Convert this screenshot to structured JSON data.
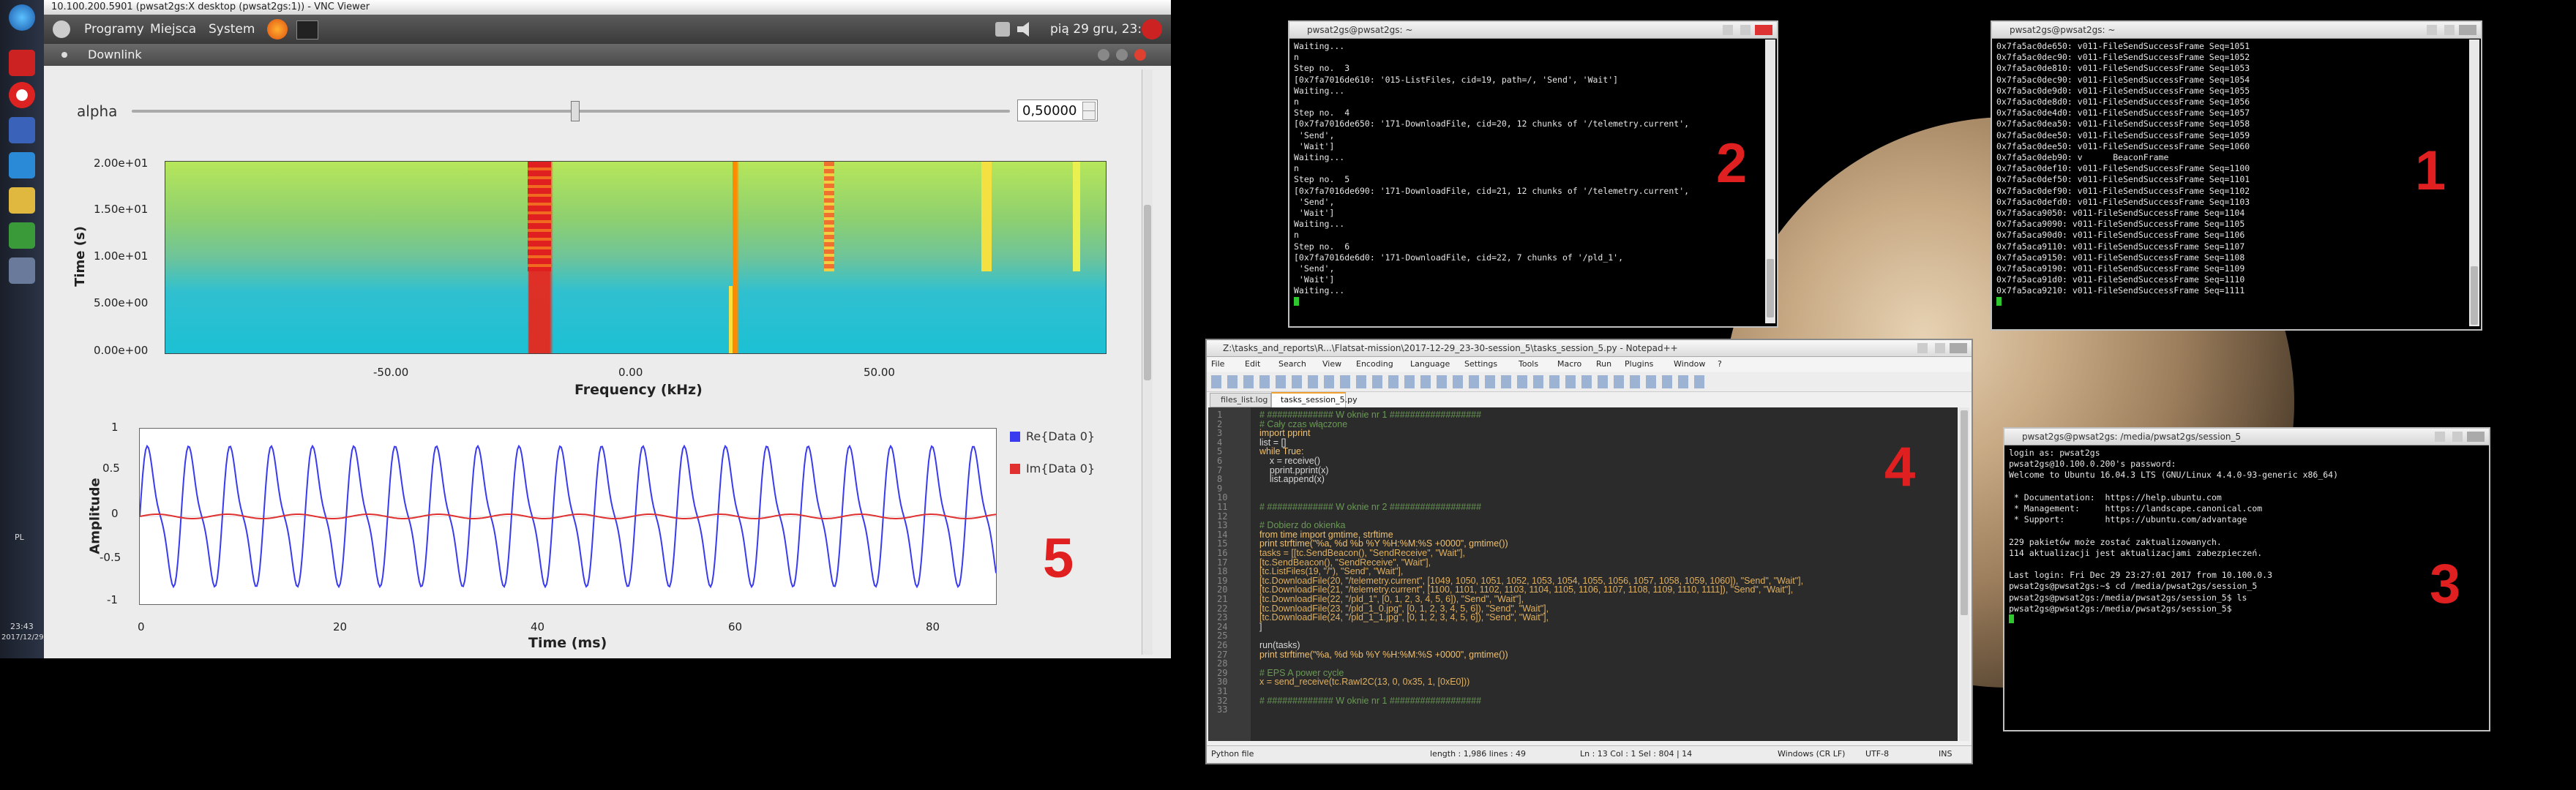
{
  "vnc": {
    "title": "10.100.200.5901 (pwsat2gs:X desktop (pwsat2gs:1)) - VNC Viewer",
    "panel_menu": [
      "Programy",
      "Miejsca",
      "System"
    ],
    "clock": "pią 29 gru, 23:43"
  },
  "win_taskbar": {
    "lang": "PL",
    "time": "23:43",
    "date": "2017/12/29"
  },
  "downlink": {
    "title": "Downlink",
    "alpha_label": "alpha",
    "alpha_value": "0,50000",
    "spectrogram": {
      "ylabel": "Time (s)",
      "xlabel": "Frequency (kHz)",
      "yticks": [
        "2.00e+01",
        "1.50e+01",
        "1.00e+01",
        "5.00e+00",
        "0.00e+00"
      ],
      "xticks": [
        "-50.00",
        "0.00",
        "50.00"
      ]
    },
    "waveform": {
      "ylabel": "Amplitude",
      "xlabel": "Time (ms)",
      "yticks": [
        "1",
        "0.5",
        "0",
        "-0.5",
        "-1"
      ],
      "xticks": [
        "0",
        "20",
        "40",
        "60",
        "80"
      ],
      "legend": [
        "Re{Data 0}",
        "Im{Data 0}"
      ],
      "colors": {
        "re": "#3a3aee",
        "im": "#e03030"
      }
    },
    "marker": "5"
  },
  "term1": {
    "title": "pwsat2gs@pwsat2gs: ~",
    "marker": "1",
    "lines": [
      "0x7fa5ac0de650: v011-FileSendSuccessFrame Seq=1051",
      "0x7fa5ac0dec90: v011-FileSendSuccessFrame Seq=1052",
      "0x7fa5ac0de810: v011-FileSendSuccessFrame Seq=1053",
      "0x7fa5ac0dec90: v011-FileSendSuccessFrame Seq=1054",
      "0x7fa5ac0de9d0: v011-FileSendSuccessFrame Seq=1055",
      "0x7fa5ac0de8d0: v011-FileSendSuccessFrame Seq=1056",
      "0x7fa5ac0de4d0: v011-FileSendSuccessFrame Seq=1057",
      "0x7fa5ac0dea50: v011-FileSendSuccessFrame Seq=1058",
      "0x7fa5ac0dee50: v011-FileSendSuccessFrame Seq=1059",
      "0x7fa5ac0dee50: v011-FileSendSuccessFrame Seq=1060",
      "0x7fa5ac0deb90: v      BeaconFrame",
      "0x7fa5ac0def10: v011-FileSendSuccessFrame Seq=1100",
      "0x7fa5ac0def50: v011-FileSendSuccessFrame Seq=1101",
      "0x7fa5ac0def90: v011-FileSendSuccessFrame Seq=1102",
      "0x7fa5ac0defd0: v011-FileSendSuccessFrame Seq=1103",
      "0x7fa5aca9050: v011-FileSendSuccessFrame Seq=1104",
      "0x7fa5aca9090: v011-FileSendSuccessFrame Seq=1105",
      "0x7fa5aca90d0: v011-FileSendSuccessFrame Seq=1106",
      "0x7fa5aca9110: v011-FileSendSuccessFrame Seq=1107",
      "0x7fa5aca9150: v011-FileSendSuccessFrame Seq=1108",
      "0x7fa5aca9190: v011-FileSendSuccessFrame Seq=1109",
      "0x7fa5aca91d0: v011-FileSendSuccessFrame Seq=1110",
      "0x7fa5aca9210: v011-FileSendSuccessFrame Seq=1111"
    ]
  },
  "term2": {
    "title": "pwsat2gs@pwsat2gs: ~",
    "marker": "2",
    "lines": [
      "Waiting...",
      "n",
      "Step no.  3",
      "[0x7fa7016de610: '015-ListFiles, cid=19, path=/, 'Send', 'Wait']",
      "Waiting...",
      "n",
      "Step no.  4",
      "[0x7fa7016de650: '171-DownloadFile, cid=20, 12 chunks of '/telemetry.current',",
      " 'Send',",
      " 'Wait']",
      "Waiting...",
      "n",
      "Step no.  5",
      "[0x7fa7016de690: '171-DownloadFile, cid=21, 12 chunks of '/telemetry.current',",
      " 'Send',",
      " 'Wait']",
      "Waiting...",
      "n",
      "Step no.  6",
      "[0x7fa7016de6d0: '171-DownloadFile, cid=22, 7 chunks of '/pld_1',",
      " 'Send',",
      " 'Wait']",
      "Waiting..."
    ]
  },
  "term3": {
    "title": "pwsat2gs@pwsat2gs: /media/pwsat2gs/session_5",
    "marker": "3",
    "lines": [
      "login as: pwsat2gs",
      "pwsat2gs@10.100.0.200's password:",
      "Welcome to Ubuntu 16.04.3 LTS (GNU/Linux 4.4.0-93-generic x86_64)",
      "",
      " * Documentation:  https://help.ubuntu.com",
      " * Management:     https://landscape.canonical.com",
      " * Support:        https://ubuntu.com/advantage",
      "",
      "229 pakietów może zostać zaktualizowanych.",
      "114 aktualizacji jest aktualizacjami zabezpieczeń.",
      "",
      "Last login: Fri Dec 29 23:27:01 2017 from 10.100.0.3",
      "pwsat2gs@pwsat2gs:~$ cd /media/pwsat2gs/session_5",
      "pwsat2gs@pwsat2gs:/media/pwsat2gs/session_5$ ls",
      "pwsat2gs@pwsat2gs:/media/pwsat2gs/session_5$ "
    ]
  },
  "editor": {
    "title": "Z:\\tasks_and_reports\\R...\\Flatsat-mission\\2017-12-29_23-30-session_5\\tasks_session_5.py - Notepad++",
    "menu": [
      "File",
      "Edit",
      "Search",
      "View",
      "Encoding",
      "Language",
      "Settings",
      "Tools",
      "Macro",
      "Run",
      "Plugins",
      "Window",
      "?"
    ],
    "tabs": [
      "files_list.log",
      "tasks_session_5.py"
    ],
    "marker": "4",
    "status": {
      "lang": "Python file",
      "length": "length : 1,986    lines : 49",
      "pos": "Ln : 13    Col : 1    Sel : 804 | 14",
      "eol": "Windows (CR LF)",
      "enc": "UTF-8",
      "ins": "INS"
    },
    "lines": [
      "# ############# W oknie nr 1 ##################",
      "# Cały czas włączone",
      "import pprint",
      "list = []",
      "while True:",
      "    x = receive()",
      "    pprint.pprint(x)",
      "    list.append(x)",
      "",
      "",
      "# ############# W oknie nr 2 ##################",
      "",
      "# Dobierz do okienka",
      "from time import gmtime, strftime",
      "print strftime(\"%a, %d %b %Y %H:%M:%S +0000\", gmtime())",
      "tasks = [[tc.SendBeacon(), \"SendReceive\", \"Wait\"],",
      "[tc.SendBeacon(), \"SendReceive\", \"Wait\"],",
      "[tc.ListFiles(19, \"/\"), \"Send\", \"Wait\"],",
      "[tc.DownloadFile(20, \"/telemetry.current\", [1049, 1050, 1051, 1052, 1053, 1054, 1055, 1056, 1057, 1058, 1059, 1060]), \"Send\", \"Wait\"],",
      "[tc.DownloadFile(21, \"/telemetry.current\", [1100, 1101, 1102, 1103, 1104, 1105, 1106, 1107, 1108, 1109, 1110, 1111]), \"Send\", \"Wait\"],",
      "[tc.DownloadFile(22, \"/pld_1\", [0, 1, 2, 3, 4, 5, 6]), \"Send\", \"Wait\"],",
      "[tc.DownloadFile(23, \"/pld_1_0.jpg\", [0, 1, 2, 3, 4, 5, 6]), \"Send\", \"Wait\"],",
      "[tc.DownloadFile(24, \"/pld_1_1.jpg\", [0, 1, 2, 3, 4, 5, 6]), \"Send\", \"Wait\"],",
      "]",
      "",
      "run(tasks)",
      "print strftime(\"%a, %d %b %Y %H:%M:%S +0000\", gmtime())",
      "",
      "# EPS A power cycle",
      "x = send_receive(tc.RawI2C(13, 0, 0x35, 1, [0xE0]))",
      "",
      "# ############# W oknie nr 1 ##################",
      ""
    ]
  }
}
